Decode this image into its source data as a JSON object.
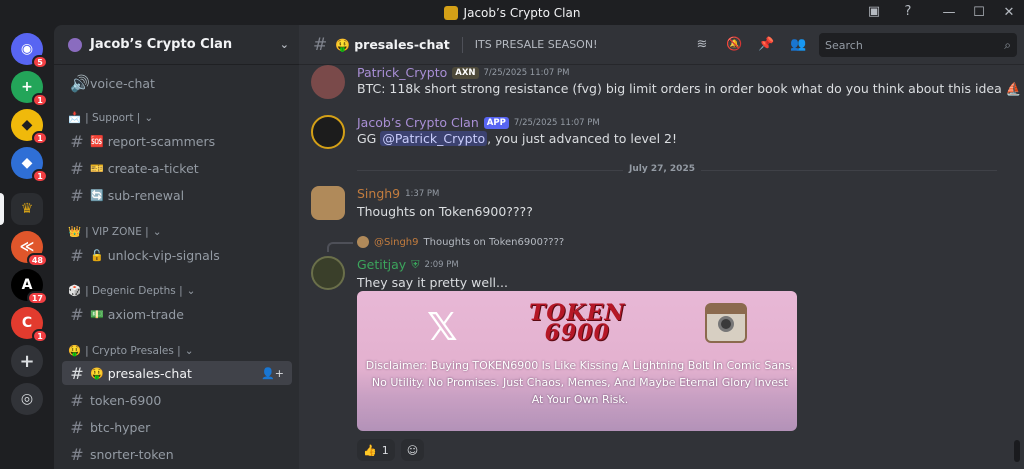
{
  "app": {
    "title": "Jacob’s Crypto Clan"
  },
  "window_controls": [
    "—",
    "☐",
    "✕"
  ],
  "servers": [
    {
      "name": "discord-home",
      "badge": "5",
      "color": "#5865f2",
      "glyph": "◉"
    },
    {
      "name": "add-server-green",
      "badge": "1",
      "color": "#23a559",
      "glyph": "+"
    },
    {
      "name": "server-binance",
      "badge": "1",
      "color": "#f0b90b",
      "glyph": "◆"
    },
    {
      "name": "server-blue-diamond",
      "badge": "1",
      "color": "#2f6fd6",
      "glyph": "◆"
    },
    {
      "name": "server-jacobs-crypto-clan",
      "badge": "",
      "color": "#2b2d31",
      "glyph": "♛"
    },
    {
      "name": "server-orange-arrow",
      "badge": "48",
      "color": "#e0562b",
      "glyph": "≪"
    },
    {
      "name": "server-axiom",
      "badge": "17",
      "color": "#000000",
      "glyph": "A"
    },
    {
      "name": "server-red-c",
      "badge": "1",
      "color": "#e23b2e",
      "glyph": "C"
    }
  ],
  "guild": {
    "name": "Jacob’s Crypto Clan"
  },
  "sidebar": {
    "voice": {
      "label": "voice-chat"
    },
    "categories": [
      {
        "label": "| Support |",
        "emoji": "📩"
      },
      {
        "label": "| VIP ZONE |",
        "emoji": "👑"
      },
      {
        "label": "| Degenic Depths |",
        "emoji": "🎲"
      },
      {
        "label": "| Crypto Presales |",
        "emoji": "🤑"
      }
    ],
    "channels": {
      "report_scammers": {
        "label": "report-scammers",
        "emoji": "🆘"
      },
      "create_ticket": {
        "label": "create-a-ticket",
        "emoji": "🎫"
      },
      "sub_renewal": {
        "label": "sub-renewal",
        "emoji": "🔄"
      },
      "unlock_vip": {
        "label": "unlock-vip-signals",
        "emoji": "🔓"
      },
      "axiom_trade": {
        "label": "axiom-trade",
        "emoji": "💵"
      },
      "presales_chat": {
        "label": "presales-chat",
        "emoji": "🤑"
      },
      "token_6900": {
        "label": "token-6900"
      },
      "btc_hyper": {
        "label": "btc-hyper"
      },
      "snorter_token": {
        "label": "snorter-token"
      }
    }
  },
  "header": {
    "channel_name": "presales-chat",
    "channel_emoji": "🤑",
    "topic": "ITS PRESALE SEASON!",
    "search_placeholder": "Search"
  },
  "messages": [
    {
      "author": "Patrick_Crypto",
      "author_color": "#a98fd6",
      "tag": "AXN",
      "timestamp": "7/25/2025 11:07 PM",
      "text": "BTC: 118k short strong resistance (fvg) big limit orders in order book what do you think about this idea ⛵"
    },
    {
      "author": "Jacob’s Crypto Clan",
      "author_color": "#a98fd6",
      "tag": "APP",
      "timestamp": "7/25/2025 11:07 PM",
      "text_prefix": "GG ",
      "mention": "@Patrick_Crypto",
      "text_suffix": ", you just advanced to level 2!"
    },
    {
      "author": "Singh9",
      "author_color": "#c27c3e",
      "timestamp": "1:37 PM",
      "text": "Thoughts on Token6900????"
    },
    {
      "author": "Getitjay",
      "author_color": "#3ba55c",
      "timestamp": "2:09 PM",
      "reply_author": "@Singh9",
      "reply_text": "Thoughts on Token6900????",
      "text": "They say it pretty well..."
    }
  ],
  "date_divider": "July 27, 2025",
  "embed": {
    "x_glyph": "𝕏",
    "token_line1": "TOKEN",
    "token_line2": "6900",
    "disclaimer": "Disclaimer: Buying TOKEN6900 Is Like Kissing A Lightning Bolt In Comic Sans. No Utility. No Promises. Just Chaos, Memes, And Maybe Eternal Glory Invest At Your Own Risk."
  },
  "reactions": [
    {
      "emoji": "👍",
      "count": "1"
    },
    {
      "emoji": "☺",
      "count": ""
    }
  ]
}
